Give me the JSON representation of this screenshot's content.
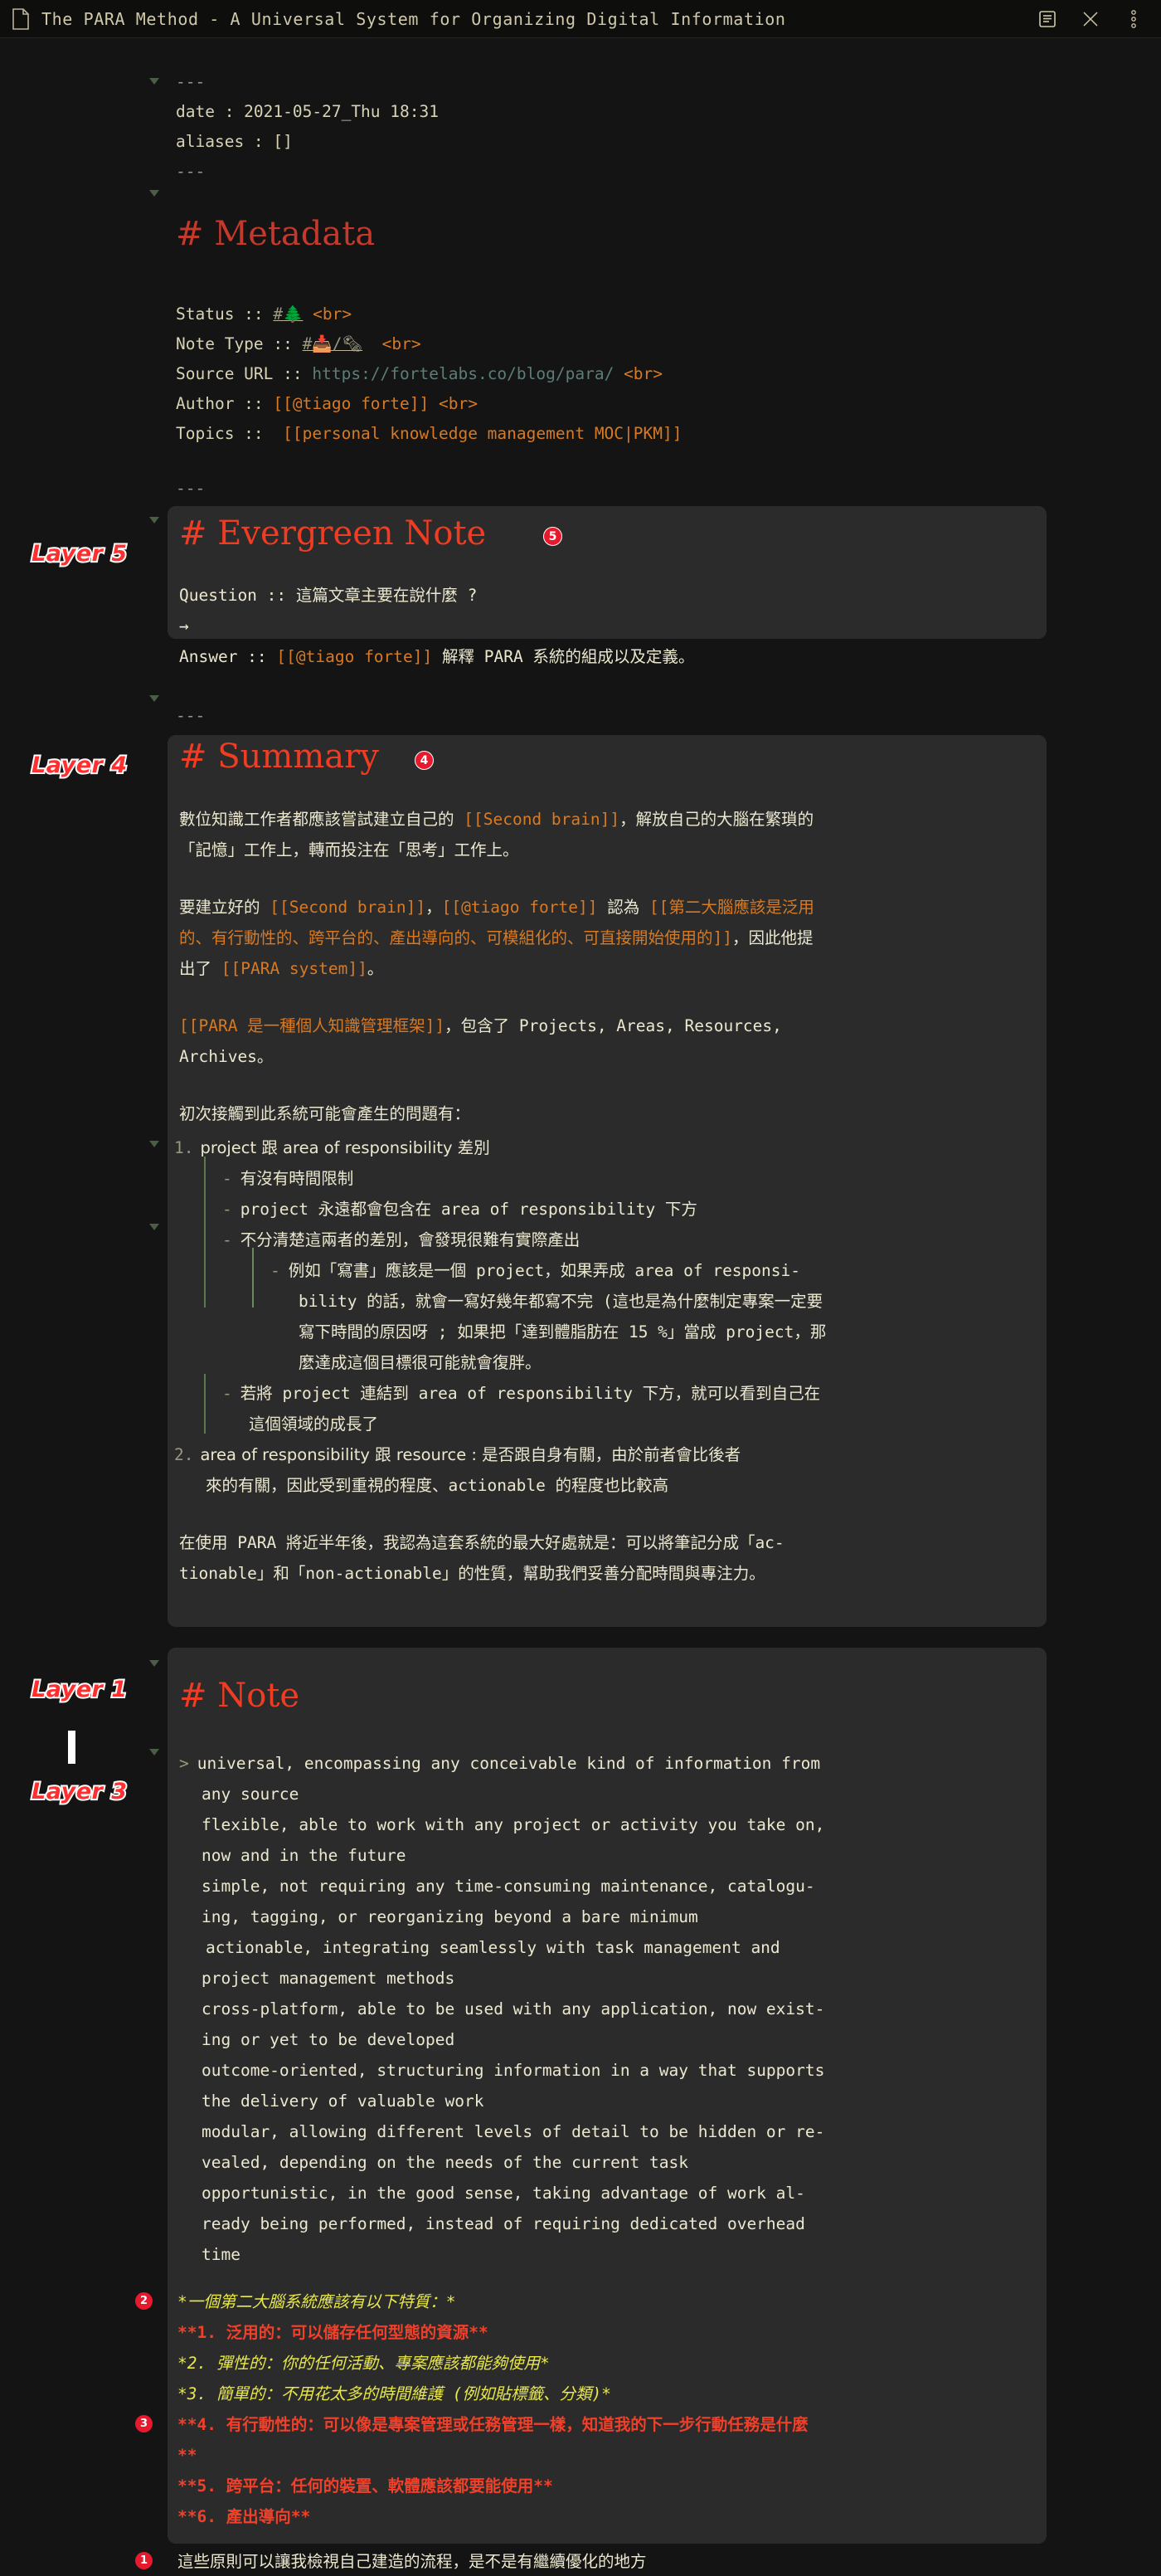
{
  "window": {
    "title": "The PARA Method - A Universal System for Organizing Digital Information",
    "icons": {
      "doc": "document-icon",
      "reader": "reader-view-icon",
      "close": "close-icon",
      "more": "more-options-icon"
    }
  },
  "frontmatter": {
    "open": "---",
    "date": "date : 2021-05-27_Thu 18:31",
    "aliases": "aliases : []",
    "close": "---"
  },
  "metadata": {
    "heading": "# Metadata",
    "rows": [
      {
        "key": "Status :: ",
        "value": "#🌲",
        "tail": " <br>"
      },
      {
        "key": "Note Type :: ",
        "value": "#📥/🗞",
        "tail": "  <br>"
      },
      {
        "key": "Source URL :: ",
        "value": "https://fortelabs.co/blog/para/",
        "tail": " <br>"
      },
      {
        "key": "Author :: ",
        "value": "[[@tiago forte]]",
        "tail": " <br>"
      },
      {
        "key": "Topics ::  ",
        "value": "[[personal knowledge management MOC|PKM]]",
        "tail": ""
      }
    ]
  },
  "divider1": "---",
  "evergreen": {
    "heading": "# Evergreen Note",
    "badge": "5",
    "layer_label": "Layer 5",
    "question": "Question :: 這篇文章主要在說什麼 ?",
    "arrow": "→",
    "answer_prefix": "Answer :: ",
    "answer_link": "[[@tiago forte]]",
    "answer_rest": " 解釋 PARA 系統的組成以及定義。"
  },
  "divider2": "---",
  "summary": {
    "heading": "# Summary",
    "badge": "4",
    "layer_label": "Layer 4",
    "p1": [
      {
        "t": "數位知識工作者都應該嘗試建立自己的 ",
        "c": "plain"
      },
      {
        "t": "[[Second brain]]",
        "c": "orange"
      },
      {
        "t": "，解放自己的大腦在繁瑣的",
        "c": "plain"
      }
    ],
    "p1_line2": "「記憶」工作上，轉而投注在「思考」工作上。",
    "p2_l1": [
      {
        "t": "要建立好的 ",
        "c": "plain"
      },
      {
        "t": "[[Second brain]]",
        "c": "orange"
      },
      {
        "t": "，",
        "c": "plain"
      },
      {
        "t": "[[@tiago forte]]",
        "c": "orange"
      },
      {
        "t": " 認為 ",
        "c": "plain"
      },
      {
        "t": "[[第二大腦應該是泛用",
        "c": "orange"
      }
    ],
    "p2_l2": [
      {
        "t": "的、有行動性的、跨平台的、產出導向的、可模組化的、可直接開始使用的]]",
        "c": "orange"
      },
      {
        "t": "，因此他提",
        "c": "plain"
      }
    ],
    "p2_l3": [
      {
        "t": "出了 ",
        "c": "plain"
      },
      {
        "t": "[[PARA system]]",
        "c": "orange"
      },
      {
        "t": "。",
        "c": "plain"
      }
    ],
    "p3_l1": [
      {
        "t": "[[PARA 是一種個人知識管理框架]]",
        "c": "orange"
      },
      {
        "t": "，包含了 Projects, Areas, Resources,",
        "c": "plain"
      }
    ],
    "p3_l2": "Archives。",
    "p4": "初次接觸到此系統可能會產生的問題有：",
    "list": [
      {
        "num": "1.",
        "text": "project 跟 area of responsibility 差別",
        "children": [
          {
            "bullet": "-",
            "lines": [
              "有沒有時間限制"
            ],
            "children": []
          },
          {
            "bullet": "-",
            "lines": [
              "project 永遠都會包含在 area of responsibility 下方"
            ],
            "children": []
          },
          {
            "bullet": "-",
            "lines": [
              "不分清楚這兩者的差別，會發現很難有實際產出"
            ],
            "children": [
              {
                "bullet": "-",
                "lines": [
                  "例如「寫書」應該是一個 project，如果弄成 area of responsi-",
                  "bility 的話，就會一寫好幾年都寫不完 (這也是為什麼制定專案一定要",
                  "寫下時間的原因呀 ; 如果把「達到體脂肪在 15 %」當成 project，那",
                  "麼達成這個目標很可能就會復胖。"
                ]
              }
            ]
          },
          {
            "bullet": "-",
            "lines": [
              "若將 project 連結到 area of responsibility 下方，就可以看到自己在",
              "這個領域的成長了"
            ],
            "children": []
          }
        ]
      },
      {
        "num": "2.",
        "text": "area of responsibility 跟 resource : 是否跟自身有關，由於前者會比後者",
        "text2": "來的有關，因此受到重視的程度、actionable 的程度也比較高",
        "children": []
      }
    ],
    "p5_l1": "在使用 PARA 將近半年後，我認為這套系統的最大好處就是：可以將筆記分成「ac-",
    "p5_l2": "tionable」和「non-actionable」的性質，幫助我們妥善分配時間與專注力。"
  },
  "divider3": "---",
  "note": {
    "heading": "# Note",
    "layer_label_top": "Layer 1",
    "layer_label_bottom": "Layer 3",
    "quote_marker": ">",
    "quote_lines": [
      "universal, encompassing any conceivable kind of information from",
      "any source",
      "flexible, able to work with any project or activity you take on,",
      "now and in the future",
      "simple, not requiring any time-consuming maintenance, catalogu-",
      "ing, tagging, or reorganizing beyond a bare minimum",
      "actionable, integrating seamlessly with task management and",
      "project management methods",
      "cross-platform, able to be used with any application, now exist-",
      "ing or yet to be developed",
      "outcome-oriented, structuring information in a way that supports",
      "the delivery of valuable work",
      "modular, allowing different levels of detail to be hidden or re-",
      "vealed, depending on the needs of the current task",
      "opportunistic, in the good sense, taking advantage of work al-",
      "ready being performed, instead of requiring dedicated overhead",
      "time"
    ],
    "highlight_items": [
      {
        "badge": "2",
        "text": "*一個第二大腦系統應該有以下特質：*",
        "style": "yellow-i"
      },
      {
        "badge": "",
        "text": "**1. 泛用的：可以儲存任何型態的資源**",
        "style": "red"
      },
      {
        "badge": "",
        "text": "*2. 彈性的：你的任何活動、專案應該都能夠使用*",
        "style": "yellow-i"
      },
      {
        "badge": "",
        "text": "*3. 簡單的：不用花太多的時間維護 (例如貼標籤、分類)*",
        "style": "yellow-i"
      },
      {
        "badge": "3",
        "text": "**4. 有行動性的：可以像是專案管理或任務管理一樣，知道我的下一步行動任務是什麼",
        "style": "red"
      },
      {
        "badge": "",
        "text": "**",
        "style": "red"
      },
      {
        "badge": "",
        "text": "**5. 跨平台：任何的裝置、軟體應該都要能使用**",
        "style": "red"
      },
      {
        "badge": "",
        "text": "**6. 產出導向**",
        "style": "red"
      }
    ],
    "final_badge": "1",
    "final_text": "這些原則可以讓我檢視自己建造的流程，是不是有繼續優化的地方"
  },
  "colors": {
    "background": "#141414",
    "panel": "#2b2b2b",
    "heading_red": "#c4392b",
    "heading_bright_red": "#f03c22",
    "link_orange": "#d87a23",
    "badge_red": "#e8192c",
    "text": "#ece8cf",
    "title_text": "#cfc9a9"
  }
}
